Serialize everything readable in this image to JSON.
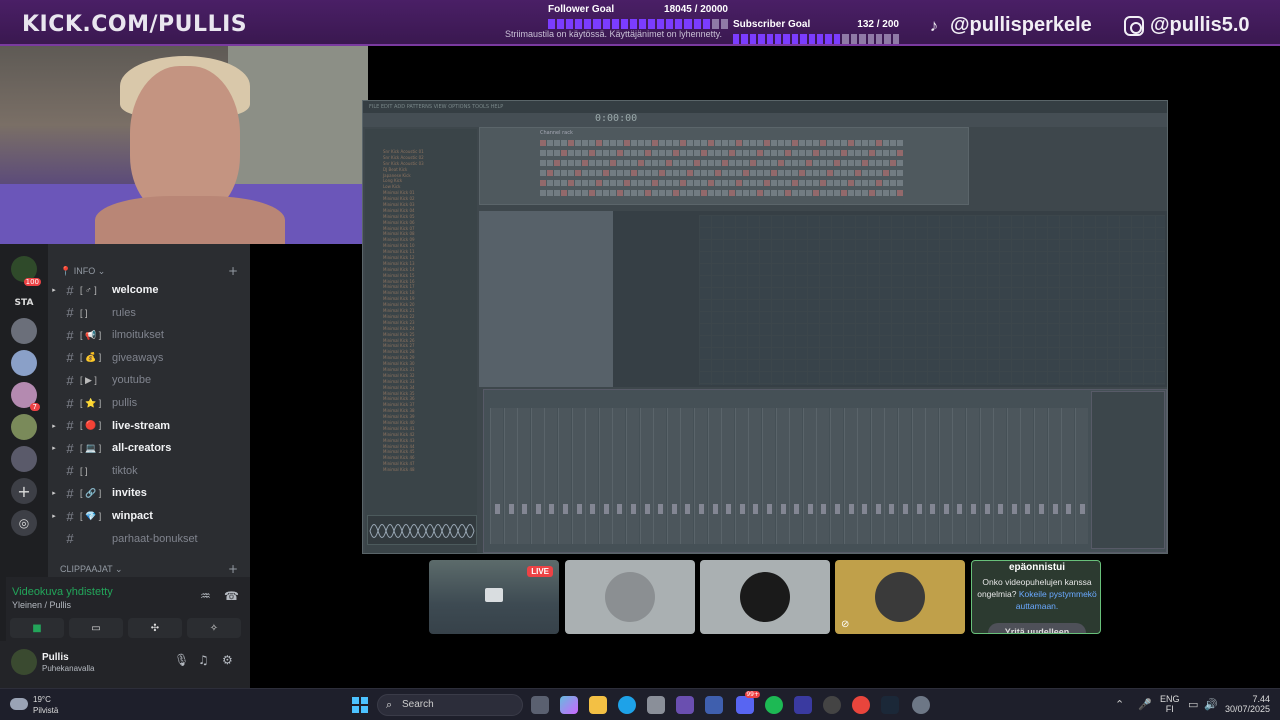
{
  "overlay": {
    "kick": "KICK.COM/PULLIS",
    "follower_goal": {
      "label": "Follower Goal",
      "value": "18045 / 20000",
      "progress": 0.9
    },
    "subscriber_goal": {
      "label": "Subscriber Goal",
      "value": "132 / 200",
      "progress": 0.66
    },
    "toast": "Striimaustila on käytössä. Käyttäjänimet on lyhennetty.",
    "tiktok": "@pullisperkele",
    "instagram": "@pullis5.0"
  },
  "discord": {
    "servers": [
      "100",
      "STA",
      "7"
    ],
    "category_info": "INFO",
    "category_clip": "CLIPPAAJAT",
    "channels": [
      {
        "emoji": "[ ♂ ]",
        "name": "welcome",
        "unread": true
      },
      {
        "emoji": "[ ]",
        "name": "rules",
        "unread": false
      },
      {
        "emoji": "[ 📢 ]",
        "name": "ilmoitukset",
        "unread": false
      },
      {
        "emoji": "[ 💰 ]",
        "name": "giveaways",
        "unread": false
      },
      {
        "emoji": "[ ▶ ]",
        "name": "youtube",
        "unread": false
      },
      {
        "emoji": "[ ⭐ ]",
        "name": "pullis",
        "unread": false
      },
      {
        "emoji": "[ 🔴 ]",
        "name": "live-stream",
        "unread": true
      },
      {
        "emoji": "[ 💻 ]",
        "name": "all-creators",
        "unread": true
      },
      {
        "emoji": "[ ]",
        "name": "tiktok",
        "unread": false
      },
      {
        "emoji": "[ 🔗 ]",
        "name": "invites",
        "unread": true
      },
      {
        "emoji": "[ 💎 ]",
        "name": "winpact",
        "unread": true
      },
      {
        "emoji": "",
        "name": "parhaat-bonukset",
        "unread": false
      }
    ],
    "voice_status": "Videokuva yhdistetty",
    "voice_channel": "Yleinen / Pullis",
    "user_name": "Pullis",
    "user_status": "Puhekanavalla"
  },
  "fl": {
    "time": "0:00:00",
    "channel_rack": "Channel rack",
    "browser_items": [
      "Snr Kick Acoustic 01",
      "Snr Kick Acoustic 02",
      "Snr Kick Acoustic 03",
      "DJ Beat Kick",
      "Japanese Kick",
      "Long Kick",
      "Low Kick",
      "Minimal Kick 01",
      "Minimal Kick 02",
      "Minimal Kick 03",
      "Minimal Kick 04",
      "Minimal Kick 05",
      "Minimal Kick 06",
      "Minimal Kick 07",
      "Minimal Kick 08",
      "Minimal Kick 09",
      "Minimal Kick 10",
      "Minimal Kick 11",
      "Minimal Kick 12",
      "Minimal Kick 13",
      "Minimal Kick 14",
      "Minimal Kick 15",
      "Minimal Kick 16",
      "Minimal Kick 17",
      "Minimal Kick 18",
      "Minimal Kick 19",
      "Minimal Kick 20",
      "Minimal Kick 21",
      "Minimal Kick 22",
      "Minimal Kick 23",
      "Minimal Kick 24",
      "Minimal Kick 25",
      "Minimal Kick 26",
      "Minimal Kick 27",
      "Minimal Kick 28",
      "Minimal Kick 29",
      "Minimal Kick 30",
      "Minimal Kick 31",
      "Minimal Kick 32",
      "Minimal Kick 33",
      "Minimal Kick 34",
      "Minimal Kick 35",
      "Minimal Kick 36",
      "Minimal Kick 37",
      "Minimal Kick 38",
      "Minimal Kick 39",
      "Minimal Kick 40",
      "Minimal Kick 41",
      "Minimal Kick 42",
      "Minimal Kick 43",
      "Minimal Kick 44",
      "Minimal Kick 45",
      "Minimal Kick 46",
      "Minimal Kick 47",
      "Minimal Kick 48"
    ]
  },
  "tiles": {
    "live": "LIVE",
    "error_title": "epäonnistui",
    "error_body": "Onko videopuhelujen kanssa ongelmia?",
    "error_link": "Kokeile pystymmekö auttamaan.",
    "error_button": "Yritä uudelleen"
  },
  "taskbar": {
    "temp": "19°C",
    "weather": "Pilvistä",
    "search": "Search",
    "lang": "ENG",
    "region": "FI",
    "time": "7.44",
    "date": "30/07/2025",
    "badge": "99+"
  }
}
